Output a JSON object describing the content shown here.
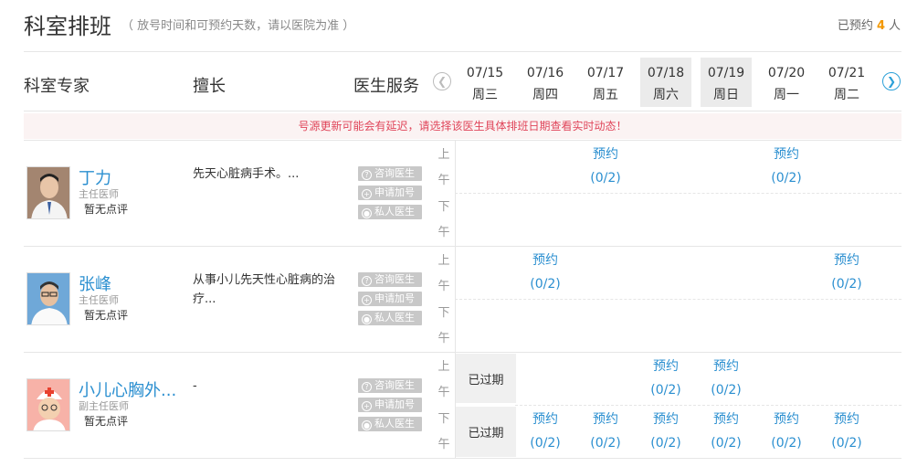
{
  "header": {
    "title": "科室排班",
    "subtitle": "（ 放号时间和可预约天数，请以医院为准 ）",
    "booked_prefix": "已预约",
    "booked_count": "4",
    "booked_suffix": "人"
  },
  "columns": {
    "doctor": "科室专家",
    "specialty": "擅长",
    "service": "医生服务",
    "prev_icon": "arrow-left-circle-icon",
    "next_icon": "arrow-right-circle-icon"
  },
  "days": [
    {
      "date": "07/15",
      "weekday": "周三"
    },
    {
      "date": "07/16",
      "weekday": "周四"
    },
    {
      "date": "07/17",
      "weekday": "周五"
    },
    {
      "date": "07/18",
      "weekday": "周六"
    },
    {
      "date": "07/19",
      "weekday": "周日"
    },
    {
      "date": "07/20",
      "weekday": "周一"
    },
    {
      "date": "07/21",
      "weekday": "周二"
    }
  ],
  "notice": "号源更新可能会有延迟，请选择该医生具体排班日期查看实时动态！",
  "labels": {
    "am_1": "上",
    "am_2": "午",
    "pm_1": "下",
    "pm_2": "午",
    "svc_consult": "咨询医生",
    "svc_add": "申请加号",
    "svc_private": "私人医生",
    "book": "预约",
    "expired": "已过期"
  },
  "doctors": [
    {
      "name": "丁力",
      "rank": "主任医师",
      "review": "暂无点评",
      "specialty": "先天心脏病手术。...",
      "am_slots": [
        "(0/2)",
        "(0/2)"
      ],
      "pm_slots": []
    },
    {
      "name": "张峰",
      "rank": "主任医师",
      "review": "暂无点评",
      "specialty": "从事小儿先天性心脏病的治疗...",
      "am_slots": [
        "(0/2)",
        "(0/2)"
      ],
      "pm_slots": []
    },
    {
      "name": "小儿心胸外...",
      "rank": "副主任医师",
      "review": "暂无点评",
      "specialty": "-",
      "am_slots": [
        "(0/2)",
        "(0/2)"
      ],
      "pm_slots": [
        "(0/2)",
        "(0/2)",
        "(0/2)",
        "(0/2)",
        "(0/2)",
        "(0/2)"
      ]
    }
  ]
}
